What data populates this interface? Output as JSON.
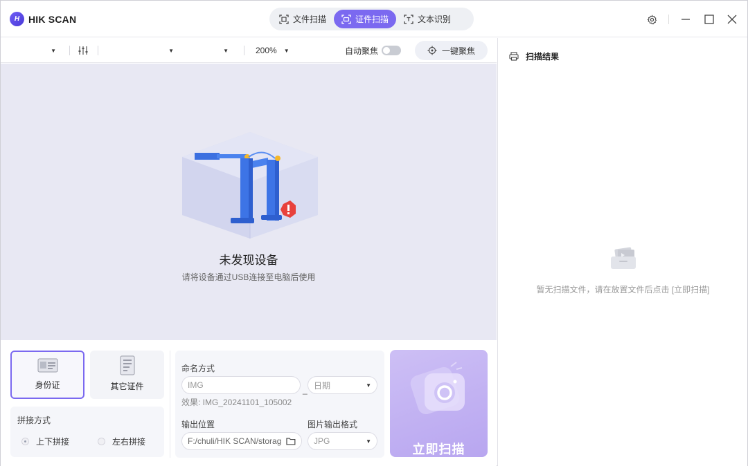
{
  "app": {
    "logo_text": "HIK SCAN",
    "logo_mark": "H"
  },
  "mode_tabs": [
    {
      "label": "文件扫描",
      "icon": "document-scan-icon",
      "active": false
    },
    {
      "label": "证件扫描",
      "icon": "id-scan-icon",
      "active": true
    },
    {
      "label": "文本识别",
      "icon": "text-recognition-icon",
      "active": false
    }
  ],
  "window_controls": [
    "settings-icon",
    "minimize-icon",
    "maximize-icon",
    "close-icon"
  ],
  "toolbar": {
    "device_select": "",
    "resolution_select": "",
    "mode_select": "",
    "zoom": "200%",
    "auto_focus_label": "自动聚焦",
    "auto_focus_on": false,
    "one_key_focus_label": "一键聚焦"
  },
  "preview": {
    "title": "未发现设备",
    "subtitle": "请将设备通过USB连接至电脑后使用"
  },
  "doc_types": [
    {
      "label": "身份证",
      "icon": "id-card-icon",
      "selected": true
    },
    {
      "label": "其它证件",
      "icon": "other-document-icon",
      "selected": false
    }
  ],
  "stitch": {
    "label": "拼接方式",
    "options": [
      {
        "label": "上下拼接",
        "selected": true
      },
      {
        "label": "左右拼接",
        "selected": false
      }
    ]
  },
  "naming": {
    "label": "命名方式",
    "prefix_placeholder": "IMG",
    "separator": "_",
    "suffix_value": "日期",
    "effect_text": "效果: IMG_20241101_105002"
  },
  "output": {
    "location_label": "输出位置",
    "location_value": "F:/chuli/HIK SCAN/storag",
    "format_label": "图片输出格式",
    "format_value": "JPG"
  },
  "scan_button": {
    "label": "立即扫描"
  },
  "results": {
    "title": "扫描结果",
    "empty_text": "暂无扫描文件，请在放置文件后点击 [立即扫描]"
  },
  "colors": {
    "accent": "#7b69f0",
    "preview_bg": "#e8e8f3",
    "scan_button": "#c4b5f3",
    "error": "#e8413c"
  }
}
